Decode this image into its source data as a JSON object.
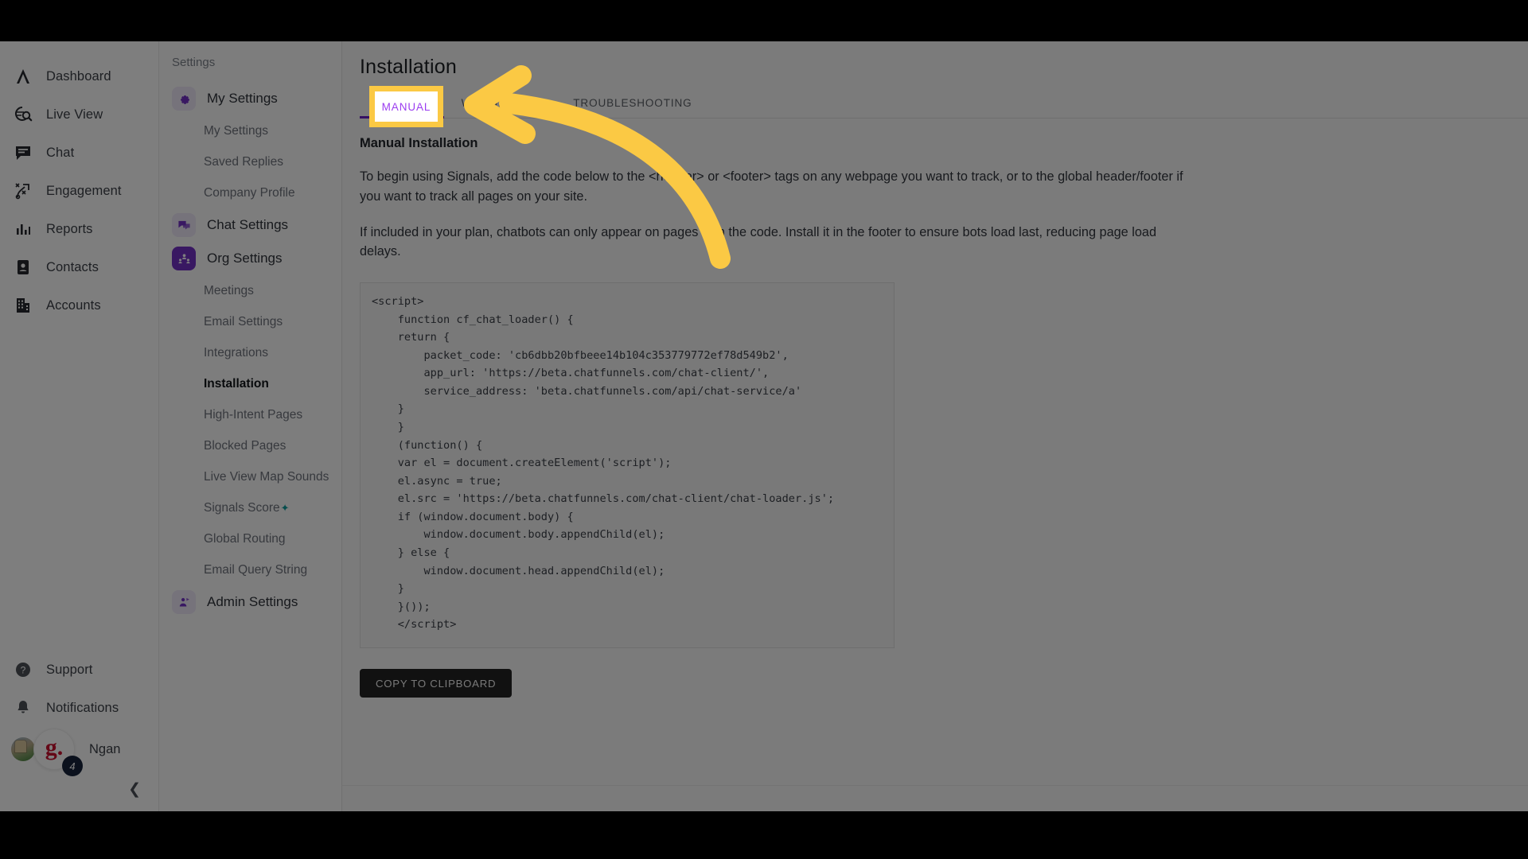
{
  "colors": {
    "accent_purple": "#7230c4",
    "tab_active_purple": "#6b21c7",
    "highlight_yellow": "#fbc944",
    "highlight_text_purple": "#9b3df0",
    "signals_star_teal": "#0f9a9a",
    "badge_navy": "#17233b",
    "logo_red": "#c8102e",
    "copy_button_bg": "#222222"
  },
  "rail": {
    "items": [
      {
        "label": "Dashboard",
        "icon": "lambda-logo-icon"
      },
      {
        "label": "Live View",
        "icon": "globe-search-icon"
      },
      {
        "label": "Chat",
        "icon": "chat-bubble-icon"
      },
      {
        "label": "Engagement",
        "icon": "engagement-play-icon"
      },
      {
        "label": "Reports",
        "icon": "bar-chart-icon"
      },
      {
        "label": "Contacts",
        "icon": "contact-card-icon"
      },
      {
        "label": "Accounts",
        "icon": "building-icon"
      }
    ],
    "bottom": [
      {
        "label": "Support",
        "icon": "question-circle-icon"
      },
      {
        "label": "Notifications",
        "icon": "bell-icon"
      }
    ],
    "user": {
      "name": "Ngan",
      "org_initial": "g.",
      "notification_count": "4"
    },
    "collapse_icon": "chevron-left-icon"
  },
  "settings": {
    "title": "Settings",
    "groups": [
      {
        "label": "My Settings",
        "icon": "gear-icon",
        "active": false,
        "children": [
          {
            "label": "My Settings"
          },
          {
            "label": "Saved Replies"
          },
          {
            "label": "Company Profile"
          }
        ]
      },
      {
        "label": "Chat Settings",
        "icon": "chat-settings-icon",
        "active": false,
        "children": []
      },
      {
        "label": "Org Settings",
        "icon": "org-people-icon",
        "active": true,
        "children": [
          {
            "label": "Meetings"
          },
          {
            "label": "Email Settings"
          },
          {
            "label": "Integrations"
          },
          {
            "label": "Installation",
            "current": true
          },
          {
            "label": "High-Intent Pages"
          },
          {
            "label": "Blocked Pages"
          },
          {
            "label": "Live View Map Sounds"
          },
          {
            "label": "Signals Score",
            "superscript": "✦"
          },
          {
            "label": "Global Routing"
          },
          {
            "label": "Email Query String"
          }
        ]
      },
      {
        "label": "Admin Settings",
        "icon": "admin-shield-icon",
        "active": false,
        "children": []
      }
    ]
  },
  "main": {
    "page_title": "Installation",
    "tabs": [
      {
        "label": "MANUAL",
        "active": true
      },
      {
        "label": "WORDPRESS",
        "active": false
      },
      {
        "label": "TROUBLESHOOTING",
        "active": false
      }
    ],
    "section_heading": "Manual Installation",
    "paragraph_1": "To begin using Signals, add the code below to the <header> or <footer> tags on any webpage you want to track, or to the global header/footer if you want to track all pages on your site.",
    "paragraph_2": "If included in your plan, chatbots can only appear on pages with the code. Install it in the footer to ensure bots load last, reducing page load delays.",
    "code_snippet": "<script>\n    function cf_chat_loader() {\n    return {\n        packet_code: 'cb6dbb20bfbeee14b104c353779772ef78d549b2',\n        app_url: 'https://beta.chatfunnels.com/chat-client/',\n        service_address: 'beta.chatfunnels.com/api/chat-service/a'\n    }\n    }\n    (function() {\n    var el = document.createElement('script');\n    el.async = true;\n    el.src = 'https://beta.chatfunnels.com/chat-client/chat-loader.js';\n    if (window.document.body) {\n        window.document.body.appendChild(el);\n    } else {\n        window.document.head.appendChild(el);\n    }\n    }());\n    </script>",
    "copy_button": "COPY TO CLIPBOARD"
  },
  "annotation": {
    "highlight_label": "MANUAL",
    "arrow_icon": "curved-arrow-left-icon"
  }
}
